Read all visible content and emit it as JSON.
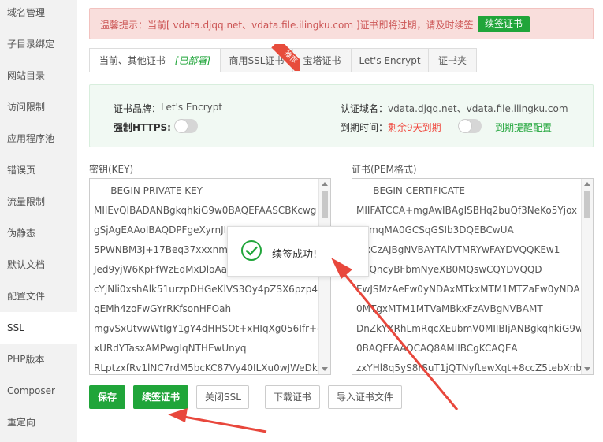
{
  "sidebar": {
    "items": [
      {
        "label": "域名管理"
      },
      {
        "label": "子目录绑定"
      },
      {
        "label": "网站目录"
      },
      {
        "label": "访问限制"
      },
      {
        "label": "应用程序池"
      },
      {
        "label": "错误页"
      },
      {
        "label": "流量限制"
      },
      {
        "label": "伪静态"
      },
      {
        "label": "默认文档"
      },
      {
        "label": "配置文件"
      },
      {
        "label": "SSL"
      },
      {
        "label": "PHP版本"
      },
      {
        "label": "Composer"
      },
      {
        "label": "重定向"
      }
    ],
    "active_item": "SSL"
  },
  "alert": {
    "text": "温馨提示：当前[ vdata.djqq.net、vdata.file.ilingku.com ]证书即将过期，请及时续签",
    "button_label": "续签证书"
  },
  "tabs": [
    {
      "label": "当前、其他证书 - ",
      "suffix": "[已部署]"
    },
    {
      "label": "商用SSL证书"
    },
    {
      "label": "宝塔证书"
    },
    {
      "label": "Let's Encrypt"
    },
    {
      "label": "证书夹"
    }
  ],
  "badge": {
    "label": "推荐"
  },
  "cert_info": {
    "brand_label": "证书品牌：",
    "brand_value": "Let's Encrypt",
    "force_https_label": "强制HTTPS:",
    "domain_label": "认证域名：",
    "domain_value": "vdata.djqq.net、vdata.file.ilingku.com",
    "expire_label": "到期时间：",
    "expire_value": "剩余9天到期",
    "reminder_link": "到期提醒配置"
  },
  "key_area": {
    "label": "密钥(KEY)",
    "lines": [
      "-----BEGIN PRIVATE KEY-----",
      "MIIEvQIBADANBgkqhkiG9w0BAQEFAASCBKcwg",
      "gSjAgEAAoIBAQDPFgeXyrnJI",
      "5PWNBM3J+17Beq37xxxnm1",
      "Jed9yjW6KpFfWzEdMxDloAam",
      "cYjNli0xshAlk51urzpDHGeKlVS3Oy4pZSX6pzp40",
      "qEMh4zoFwGYrRKfsonHFOah",
      "mgvSxUtvwWtIgY1gY4dHHSOt+xHIqXg056Ifr+g",
      "xURdYTasxAMPwgIqNTHEwUnyq",
      "RLptzxfRv1lNC7rdM5bcKC87Vy40ILXu0wJWeDkr"
    ]
  },
  "cert_area": {
    "label": "证书(PEM格式)",
    "lines": [
      "-----BEGIN CERTIFICATE-----",
      "MIIFATCCA+mgAwIBAgISBHq2buQf3NeKo5Yjox",
      "HxmqMA0GCSqGSIb3DQEBCwUA",
      "0lxCzAJBgNVBAYTAlVTMRYwFAYDVQQKEw1",
      "ZXQncyBFbmNyeXB0MQswCQYDVQQD",
      "EwJSMzAeFw0yNDAxMTkxMTM1MTZaFw0yNDA",
      "0MTgxMTM1MTVaMBkxFzAVBgNVBAMT",
      "DnZkYXRhLmRqcXEubmV0MIIBIjANBgkqhkiG9w",
      "0BAQEFAAOCAQ8AMIIBCgKCAQEA",
      "zxYHl8q5yS8rSuT1jQTNyftewXqt+8ccZ5tebXnba"
    ]
  },
  "toast": {
    "text": "续签成功!"
  },
  "buttons": {
    "save": "保存",
    "renew": "续签证书",
    "close_ssl": "关闭SSL",
    "download": "下载证书",
    "import": "导入证书文件"
  },
  "colors": {
    "accent": "#20a53a",
    "danger": "#f0463c",
    "alert_bg": "#f9dedc",
    "info_bg": "#f1f9f3",
    "annotation_arrow": "#e8473c"
  },
  "icons": {
    "toast": "check-circle-icon",
    "annotation": "red-arrow"
  }
}
